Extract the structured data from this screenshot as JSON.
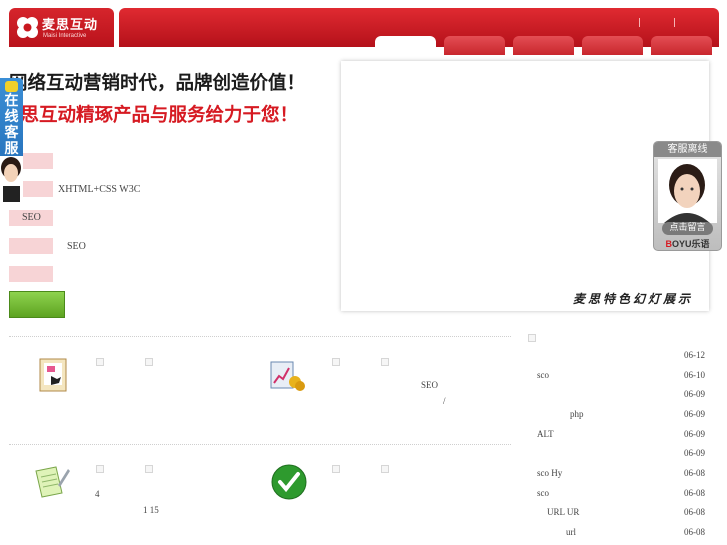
{
  "header": {
    "logo_cn": "麦思互动",
    "logo_en": "Maisi Interactive",
    "nav_tabs": [
      "",
      "",
      "",
      "",
      ""
    ]
  },
  "hero": {
    "slogan_line1": "网络互动营销时代，品牌创造价值！",
    "slogan_line2": "麦思互动精琢产品与服务给力于您！",
    "features": [
      {
        "label": ""
      },
      {
        "label": "XHTML+CSS  W3C"
      },
      {
        "label": "SEO"
      },
      {
        "label": "SEO"
      },
      {
        "label": ""
      }
    ]
  },
  "online_service": {
    "label": "在线客服"
  },
  "slideshow": {
    "caption": "麦思特色幻灯展示"
  },
  "kefu_widget": {
    "title": "客服离线",
    "button": "点击留言",
    "brand_b": "B",
    "brand_rest": "OYU乐语"
  },
  "services": [
    {
      "icon": "certificate-icon",
      "text": []
    },
    {
      "icon": "seo-chart-icon",
      "text": [
        "SEO",
        "/"
      ]
    },
    {
      "icon": "notepad-pen-icon",
      "text": [
        "4",
        "1  15"
      ]
    },
    {
      "icon": "green-check-icon",
      "text": []
    }
  ],
  "news": [
    {
      "title": "",
      "date": "06-12"
    },
    {
      "title": "sco",
      "date": "06-10"
    },
    {
      "title": "",
      "date": "06-09"
    },
    {
      "title": "php",
      "date": "06-09"
    },
    {
      "title": "ALT",
      "date": "06-09"
    },
    {
      "title": "",
      "date": "06-09"
    },
    {
      "title": "sco              Hy",
      "date": "06-08"
    },
    {
      "title": "sco",
      "date": "06-08"
    },
    {
      "title": "URL         UR",
      "date": "06-08"
    },
    {
      "title": "url",
      "date": "06-08"
    }
  ],
  "colors": {
    "brand_red": "#d61a22",
    "accent_green": "#6fb52c",
    "pink_box": "#f7d4d6"
  }
}
